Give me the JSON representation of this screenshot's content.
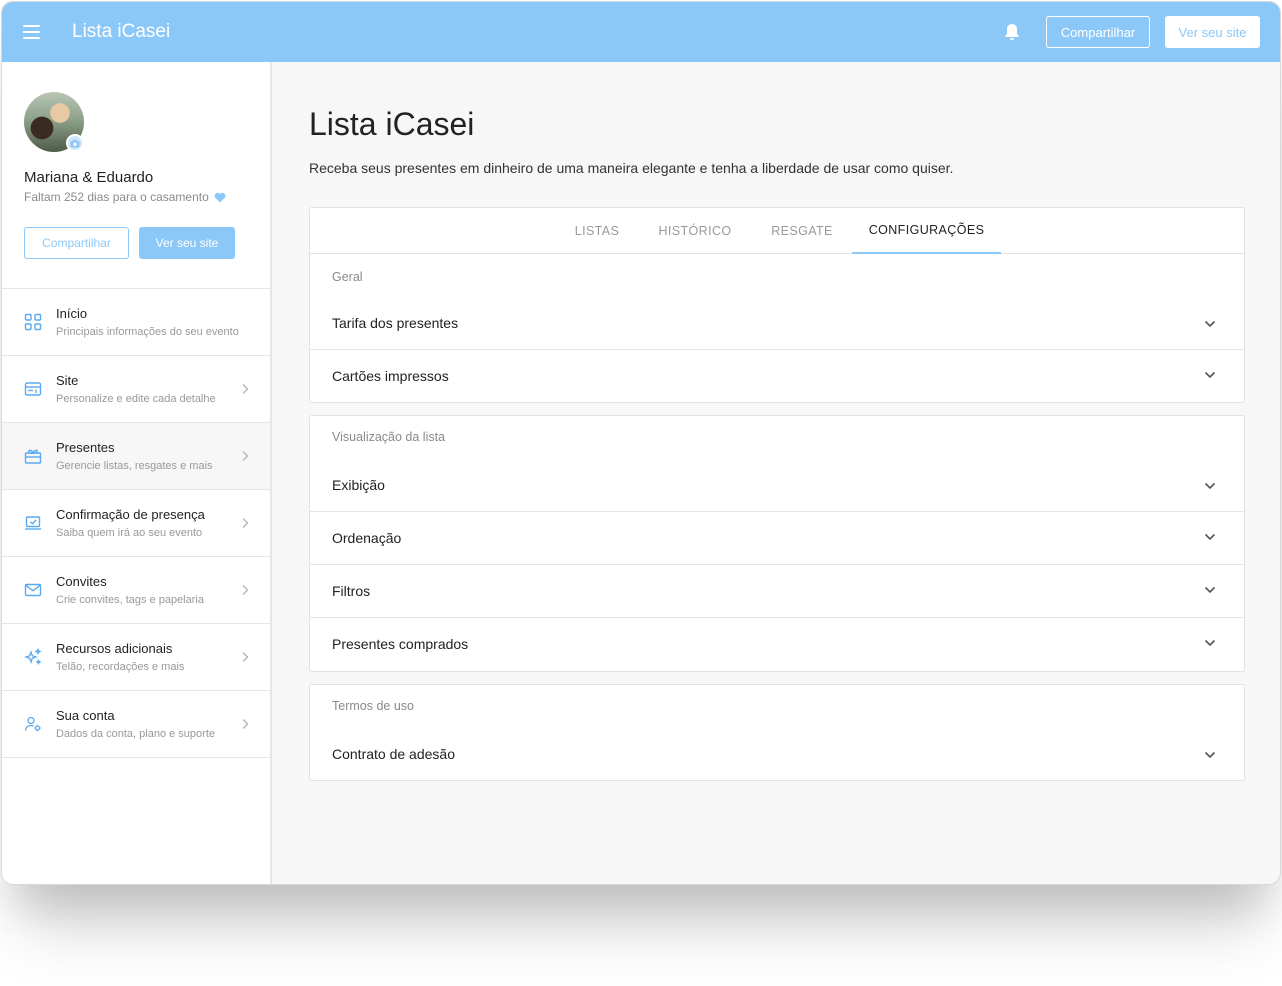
{
  "topbar": {
    "title": "Lista iCasei",
    "share_label": "Compartilhar",
    "view_site_label": "Ver seu site",
    "bg_color": "#8cc8f7"
  },
  "sidebar": {
    "couple_name": "Mariana & Eduardo",
    "countdown": "Faltam 252 dias para o casamento",
    "share_label": "Compartilhar",
    "view_site_label": "Ver seu site",
    "items": [
      {
        "icon": "grid-icon",
        "title": "Início",
        "subtitle": "Principais informações do seu evento"
      },
      {
        "icon": "browser-icon",
        "title": "Site",
        "subtitle": "Personalize e edite cada detalhe"
      },
      {
        "icon": "gift-icon",
        "title": "Presentes",
        "subtitle": "Gerencie listas, resgates e mais"
      },
      {
        "icon": "laptop-check-icon",
        "title": "Confirmação de presença",
        "subtitle": "Saiba quem irá ao seu evento"
      },
      {
        "icon": "mail-icon",
        "title": "Convites",
        "subtitle": "Crie convites, tags e papelaria"
      },
      {
        "icon": "sparkles-icon",
        "title": "Recursos adicionais",
        "subtitle": "Telão, recordações e mais"
      },
      {
        "icon": "user-gear-icon",
        "title": "Sua conta",
        "subtitle": "Dados da conta, plano e suporte"
      }
    ]
  },
  "main": {
    "title": "Lista iCasei",
    "description": "Receba seus presentes em dinheiro de uma maneira elegante e tenha a liberdade de usar como quiser.",
    "tabs": [
      {
        "label": "LISTAS"
      },
      {
        "label": "HISTÓRICO"
      },
      {
        "label": "RESGATE"
      },
      {
        "label": "CONFIGURAÇÕES"
      }
    ],
    "sections": [
      {
        "label": "Geral",
        "rows": [
          "Tarifa dos presentes",
          "Cartões impressos"
        ]
      },
      {
        "label": "Visualização da lista",
        "rows": [
          "Exibição",
          "Ordenação",
          "Filtros",
          "Presentes comprados"
        ]
      },
      {
        "label": "Termos de uso",
        "rows": [
          "Contrato de adesão"
        ]
      }
    ]
  }
}
